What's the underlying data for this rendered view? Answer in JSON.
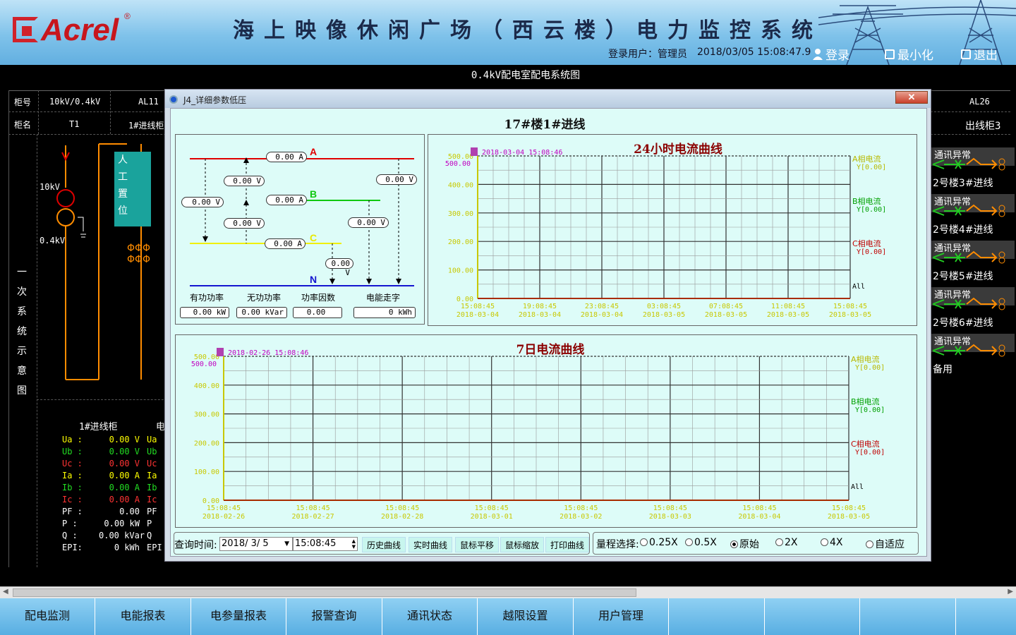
{
  "header": {
    "logo": "Acrel",
    "registered_mark": "®",
    "system_title": "海上映像休闲广场（西云楼）电力监控系统",
    "user_label": "登录用户：",
    "user_name": "管理员",
    "datetime": "2018/03/05 15:08:47.9",
    "login_label": "登录",
    "minimize_label": "最小化",
    "exit_label": "退出"
  },
  "diagram": {
    "title": "0.4kV配电室配电系统图",
    "row_cabinet_no": "柜号",
    "row_cabinet_name": "柜名",
    "cabinet_no_1": "10kV/0.4kV",
    "cabinet_no_2": "AL11",
    "cabinet_no_last": "AL26",
    "cabinet_name_1": "T1",
    "cabinet_name_2": "1#进线柜",
    "cabinet_name_last": "出线柜3",
    "voltage_high": "10kV",
    "voltage_low": "0.4kV",
    "manual_position": [
      "人",
      "工",
      "置",
      "位"
    ],
    "side_label": [
      "一",
      "次",
      "系",
      "统",
      "示",
      "意",
      "图"
    ],
    "panel_title": "1#进线柜",
    "panel_title_2": "电",
    "measurements": [
      {
        "k": "Ua :",
        "v": "0.00 V",
        "c": "y"
      },
      {
        "k": "Ub :",
        "v": "0.00 V",
        "c": "g"
      },
      {
        "k": "Uc :",
        "v": "0.00 V",
        "c": "r"
      },
      {
        "k": "Ia :",
        "v": "0.00 A",
        "c": "y"
      },
      {
        "k": "Ib :",
        "v": "0.00 A",
        "c": "g"
      },
      {
        "k": "Ic :",
        "v": "0.00 A",
        "c": "r"
      },
      {
        "k": "PF :",
        "v": "0.00",
        "c": "w"
      },
      {
        "k": "P  :",
        "v": "0.00 kW",
        "c": "w"
      },
      {
        "k": "Q  :",
        "v": "0.00 kVar",
        "c": "w"
      },
      {
        "k": "EPI:",
        "v": "0 kWh",
        "c": "w"
      }
    ],
    "measurements_2": [
      "Ua",
      "Ub",
      "Uc",
      "Ia",
      "Ib",
      "Ic",
      "PF",
      "P",
      "Q",
      "EPI"
    ],
    "right_column": [
      {
        "alarm": "通讯异常",
        "name": "2号楼3#进线"
      },
      {
        "alarm": "通讯异常",
        "name": "2号楼4#进线"
      },
      {
        "alarm": "通讯异常",
        "name": "2号楼5#进线"
      },
      {
        "alarm": "通讯异常",
        "name": "2号楼6#进线"
      },
      {
        "alarm": "通讯异常",
        "name": "备用"
      }
    ]
  },
  "dialog": {
    "title": "J4_详细参数低压",
    "close_label": "✕",
    "heading": "17#楼1#进线",
    "phases": {
      "a": "A",
      "b": "B",
      "c": "C",
      "n": "N"
    },
    "phase_colors": {
      "a": "#e00000",
      "b": "#10c810",
      "c": "#f0f000",
      "n": "#1515d0"
    },
    "boxes": {
      "ia": "0.00 A",
      "ib": "0.00 A",
      "ic": "0.00 A",
      "uab": "0.00 V",
      "ubc": "0.00 V",
      "uca": "0.00 V",
      "ua": "0.00 V",
      "ub": "0.00 V",
      "uc": "0.00 V"
    },
    "labels": {
      "p": "有功功率",
      "q": "无功功率",
      "pf": "功率因数",
      "e": "电能走字"
    },
    "values": {
      "p": "0.00 kW",
      "q": "0.00 kVar",
      "pf": "0.00",
      "e": "0 kWh"
    },
    "toolbar": {
      "query_label": "查询时间:",
      "date": "2018/ 3/ 5",
      "time": "15:08:45",
      "history": "历史曲线",
      "realtime": "实时曲线",
      "pan": "鼠标平移",
      "zoom": "鼠标缩放",
      "print": "打印曲线",
      "range_label": "量程选择:",
      "ranges": [
        "0.25X",
        "0.5X",
        "原始",
        "2X",
        "4X",
        "自适应"
      ],
      "selected_range": "原始"
    }
  },
  "chart_data": [
    {
      "type": "line",
      "title": "24小时电流曲线",
      "cursor_label": "2018-03-04 15:08:46",
      "ylim": [
        0,
        500
      ],
      "y_ticks": [
        "0.00",
        "100.00",
        "200.00",
        "300.00",
        "400.00",
        "500.00"
      ],
      "y_top_label": "500.00",
      "x_ticks": [
        [
          "15:08:45",
          "2018-03-04"
        ],
        [
          "19:08:45",
          "2018-03-04"
        ],
        [
          "23:08:45",
          "2018-03-04"
        ],
        [
          "03:08:45",
          "2018-03-05"
        ],
        [
          "07:08:45",
          "2018-03-05"
        ],
        [
          "11:08:45",
          "2018-03-05"
        ],
        [
          "15:08:45",
          "2018-03-05"
        ]
      ],
      "grid": true,
      "legend_position": "right",
      "series": [
        {
          "name": "A相电流",
          "value_label": "Y[0.00]",
          "color": "#b8b800",
          "values": [
            0,
            0
          ]
        },
        {
          "name": "B相电流",
          "value_label": "Y[0.00]",
          "color": "#00a000",
          "values": [
            0,
            0
          ]
        },
        {
          "name": "C相电流",
          "value_label": "Y[0.00]",
          "color": "#c00000",
          "values": [
            0,
            0
          ]
        }
      ],
      "all_label": "All"
    },
    {
      "type": "line",
      "title": "7日电流曲线",
      "cursor_label": "2018-02-26 15:08:46",
      "ylim": [
        0,
        500
      ],
      "y_ticks": [
        "0.00",
        "100.00",
        "200.00",
        "300.00",
        "400.00",
        "500.00"
      ],
      "y_top_label": "500.00",
      "x_ticks": [
        [
          "15:08:45",
          "2018-02-26"
        ],
        [
          "15:08:45",
          "2018-02-27"
        ],
        [
          "15:08:45",
          "2018-02-28"
        ],
        [
          "15:08:45",
          "2018-03-01"
        ],
        [
          "15:08:45",
          "2018-03-02"
        ],
        [
          "15:08:45",
          "2018-03-03"
        ],
        [
          "15:08:45",
          "2018-03-04"
        ],
        [
          "15:08:45",
          "2018-03-05"
        ]
      ],
      "grid": true,
      "legend_position": "right",
      "series": [
        {
          "name": "A相电流",
          "value_label": "Y[0.00]",
          "color": "#b8b800",
          "values": [
            0,
            0
          ]
        },
        {
          "name": "B相电流",
          "value_label": "Y[0.00]",
          "color": "#00a000",
          "values": [
            0,
            0
          ]
        },
        {
          "name": "C相电流",
          "value_label": "Y[0.00]",
          "color": "#c00000",
          "values": [
            0,
            0
          ]
        }
      ],
      "all_label": "All"
    }
  ],
  "nav": [
    "配电监测",
    "电能报表",
    "电参量报表",
    "报警查询",
    "通讯状态",
    "越限设置",
    "用户管理",
    "",
    "",
    "",
    ""
  ]
}
